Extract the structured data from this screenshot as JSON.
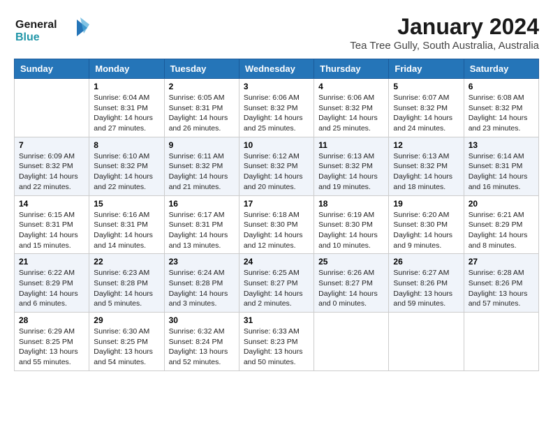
{
  "logo": {
    "line1": "General",
    "line2": "Blue"
  },
  "header": {
    "month_year": "January 2024",
    "location": "Tea Tree Gully, South Australia, Australia"
  },
  "days_of_week": [
    "Sunday",
    "Monday",
    "Tuesday",
    "Wednesday",
    "Thursday",
    "Friday",
    "Saturday"
  ],
  "weeks": [
    [
      {
        "day": "",
        "info": ""
      },
      {
        "day": "1",
        "info": "Sunrise: 6:04 AM\nSunset: 8:31 PM\nDaylight: 14 hours\nand 27 minutes."
      },
      {
        "day": "2",
        "info": "Sunrise: 6:05 AM\nSunset: 8:31 PM\nDaylight: 14 hours\nand 26 minutes."
      },
      {
        "day": "3",
        "info": "Sunrise: 6:06 AM\nSunset: 8:32 PM\nDaylight: 14 hours\nand 25 minutes."
      },
      {
        "day": "4",
        "info": "Sunrise: 6:06 AM\nSunset: 8:32 PM\nDaylight: 14 hours\nand 25 minutes."
      },
      {
        "day": "5",
        "info": "Sunrise: 6:07 AM\nSunset: 8:32 PM\nDaylight: 14 hours\nand 24 minutes."
      },
      {
        "day": "6",
        "info": "Sunrise: 6:08 AM\nSunset: 8:32 PM\nDaylight: 14 hours\nand 23 minutes."
      }
    ],
    [
      {
        "day": "7",
        "info": "Sunrise: 6:09 AM\nSunset: 8:32 PM\nDaylight: 14 hours\nand 22 minutes."
      },
      {
        "day": "8",
        "info": "Sunrise: 6:10 AM\nSunset: 8:32 PM\nDaylight: 14 hours\nand 22 minutes."
      },
      {
        "day": "9",
        "info": "Sunrise: 6:11 AM\nSunset: 8:32 PM\nDaylight: 14 hours\nand 21 minutes."
      },
      {
        "day": "10",
        "info": "Sunrise: 6:12 AM\nSunset: 8:32 PM\nDaylight: 14 hours\nand 20 minutes."
      },
      {
        "day": "11",
        "info": "Sunrise: 6:13 AM\nSunset: 8:32 PM\nDaylight: 14 hours\nand 19 minutes."
      },
      {
        "day": "12",
        "info": "Sunrise: 6:13 AM\nSunset: 8:32 PM\nDaylight: 14 hours\nand 18 minutes."
      },
      {
        "day": "13",
        "info": "Sunrise: 6:14 AM\nSunset: 8:31 PM\nDaylight: 14 hours\nand 16 minutes."
      }
    ],
    [
      {
        "day": "14",
        "info": "Sunrise: 6:15 AM\nSunset: 8:31 PM\nDaylight: 14 hours\nand 15 minutes."
      },
      {
        "day": "15",
        "info": "Sunrise: 6:16 AM\nSunset: 8:31 PM\nDaylight: 14 hours\nand 14 minutes."
      },
      {
        "day": "16",
        "info": "Sunrise: 6:17 AM\nSunset: 8:31 PM\nDaylight: 14 hours\nand 13 minutes."
      },
      {
        "day": "17",
        "info": "Sunrise: 6:18 AM\nSunset: 8:30 PM\nDaylight: 14 hours\nand 12 minutes."
      },
      {
        "day": "18",
        "info": "Sunrise: 6:19 AM\nSunset: 8:30 PM\nDaylight: 14 hours\nand 10 minutes."
      },
      {
        "day": "19",
        "info": "Sunrise: 6:20 AM\nSunset: 8:30 PM\nDaylight: 14 hours\nand 9 minutes."
      },
      {
        "day": "20",
        "info": "Sunrise: 6:21 AM\nSunset: 8:29 PM\nDaylight: 14 hours\nand 8 minutes."
      }
    ],
    [
      {
        "day": "21",
        "info": "Sunrise: 6:22 AM\nSunset: 8:29 PM\nDaylight: 14 hours\nand 6 minutes."
      },
      {
        "day": "22",
        "info": "Sunrise: 6:23 AM\nSunset: 8:28 PM\nDaylight: 14 hours\nand 5 minutes."
      },
      {
        "day": "23",
        "info": "Sunrise: 6:24 AM\nSunset: 8:28 PM\nDaylight: 14 hours\nand 3 minutes."
      },
      {
        "day": "24",
        "info": "Sunrise: 6:25 AM\nSunset: 8:27 PM\nDaylight: 14 hours\nand 2 minutes."
      },
      {
        "day": "25",
        "info": "Sunrise: 6:26 AM\nSunset: 8:27 PM\nDaylight: 14 hours\nand 0 minutes."
      },
      {
        "day": "26",
        "info": "Sunrise: 6:27 AM\nSunset: 8:26 PM\nDaylight: 13 hours\nand 59 minutes."
      },
      {
        "day": "27",
        "info": "Sunrise: 6:28 AM\nSunset: 8:26 PM\nDaylight: 13 hours\nand 57 minutes."
      }
    ],
    [
      {
        "day": "28",
        "info": "Sunrise: 6:29 AM\nSunset: 8:25 PM\nDaylight: 13 hours\nand 55 minutes."
      },
      {
        "day": "29",
        "info": "Sunrise: 6:30 AM\nSunset: 8:25 PM\nDaylight: 13 hours\nand 54 minutes."
      },
      {
        "day": "30",
        "info": "Sunrise: 6:32 AM\nSunset: 8:24 PM\nDaylight: 13 hours\nand 52 minutes."
      },
      {
        "day": "31",
        "info": "Sunrise: 6:33 AM\nSunset: 8:23 PM\nDaylight: 13 hours\nand 50 minutes."
      },
      {
        "day": "",
        "info": ""
      },
      {
        "day": "",
        "info": ""
      },
      {
        "day": "",
        "info": ""
      }
    ]
  ]
}
